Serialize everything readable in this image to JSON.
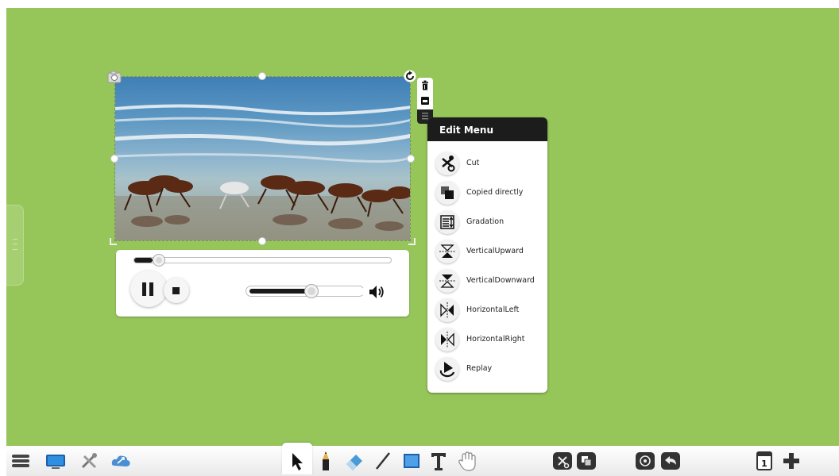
{
  "canvas": {
    "background": "#96c65a"
  },
  "edit_menu": {
    "title": "Edit Menu",
    "items": [
      {
        "label": "Cut",
        "icon": "scissors-icon"
      },
      {
        "label": "Copied directly",
        "icon": "copy-icon"
      },
      {
        "label": "Gradation",
        "icon": "layer-order-icon"
      },
      {
        "label": "VerticalUpward",
        "icon": "flip-vertical-up-icon"
      },
      {
        "label": "VerticalDownward",
        "icon": "flip-vertical-down-icon"
      },
      {
        "label": "HorizontalLeft",
        "icon": "flip-horizontal-left-icon"
      },
      {
        "label": "HorizontalRight",
        "icon": "flip-horizontal-right-icon"
      },
      {
        "label": "Replay",
        "icon": "replay-icon"
      }
    ]
  },
  "player": {
    "progress": 0.07,
    "volume": 0.55,
    "state": "playing"
  },
  "video": {
    "subject": "horses-running-on-beach"
  },
  "bottom_toolbar": {
    "left": [
      "menu-icon",
      "display-icon",
      "tools-icon",
      "cloud-icon"
    ],
    "center": [
      "select-arrow-icon",
      "pencil-icon",
      "eraser-icon",
      "line-icon",
      "rectangle-icon",
      "text-icon",
      "hand-icon"
    ],
    "right": [
      "cut-icon",
      "copy-icon",
      "roam-icon",
      "undo-icon",
      "page-icon",
      "add-page-icon"
    ],
    "page_number": "1"
  }
}
